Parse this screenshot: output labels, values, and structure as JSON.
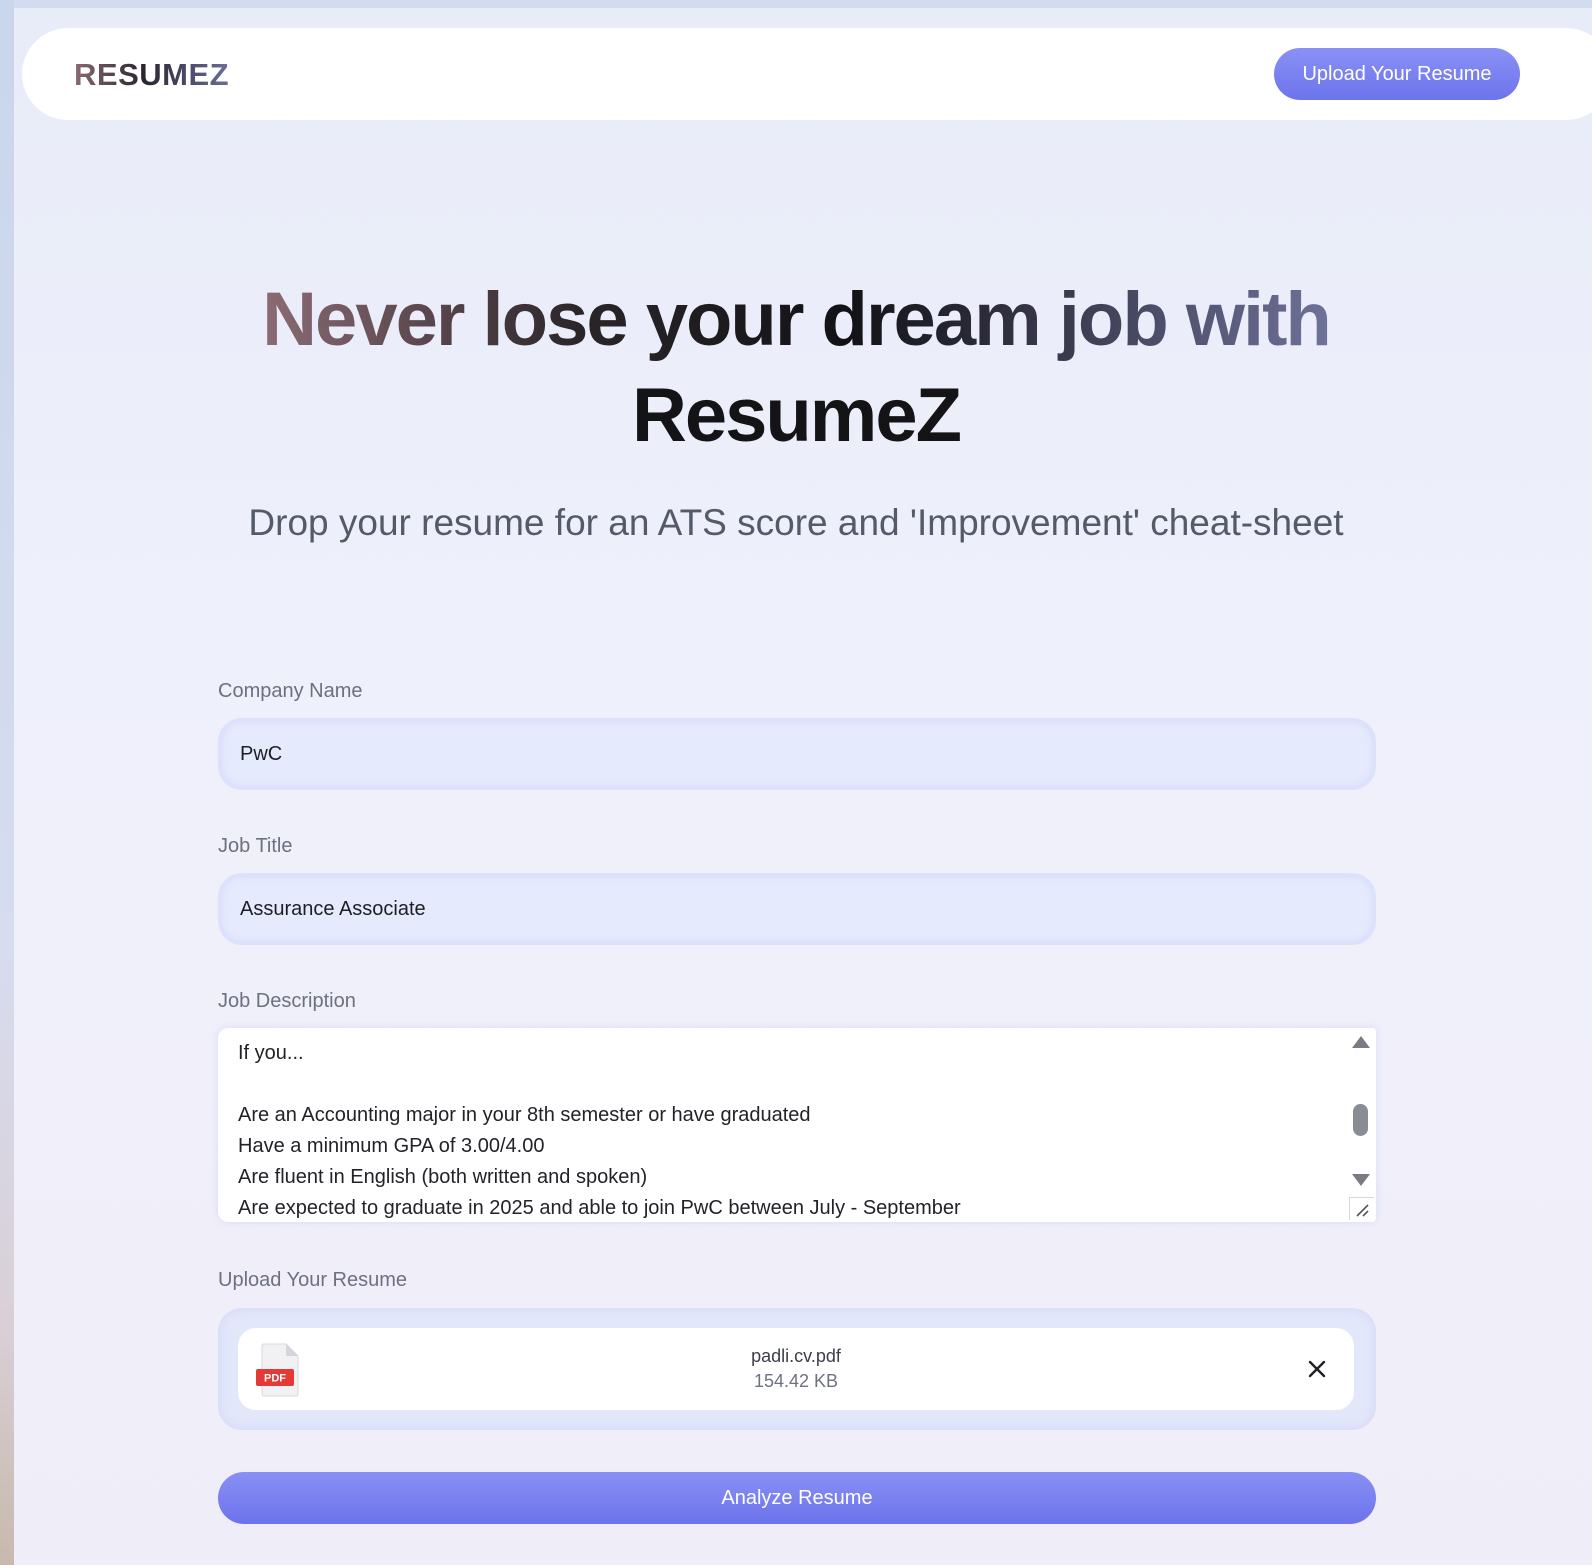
{
  "navbar": {
    "brand": "RESUMEZ",
    "upload_label": "Upload Your Resume"
  },
  "hero": {
    "title_line1": "Never lose your dream job with",
    "title_line2": "ResumeZ",
    "subtitle": "Drop your resume for an ATS score and 'Improvement' cheat-sheet"
  },
  "form": {
    "company": {
      "label": "Company Name",
      "value": "PwC"
    },
    "job_title": {
      "label": "Job Title",
      "value": "Assurance Associate"
    },
    "job_description": {
      "label": "Job Description",
      "value": "If you...\n\nAre an Accounting major in your 8th semester or have graduated\nHave a minimum GPA of 3.00/4.00\nAre fluent in English (both written and spoken)\nAre expected to graduate in 2025 and able to join PwC between July - September"
    },
    "upload": {
      "label": "Upload Your Resume",
      "file_name": "padli.cv.pdf",
      "file_size": "154.42 KB",
      "file_badge": "PDF"
    },
    "analyze_label": "Analyze Resume"
  },
  "icons": {
    "file": "pdf-file-icon",
    "remove": "close-icon"
  },
  "colors": {
    "accent": "#7a82f2",
    "background": "#eef0fb",
    "pdf_red": "#e53935"
  }
}
